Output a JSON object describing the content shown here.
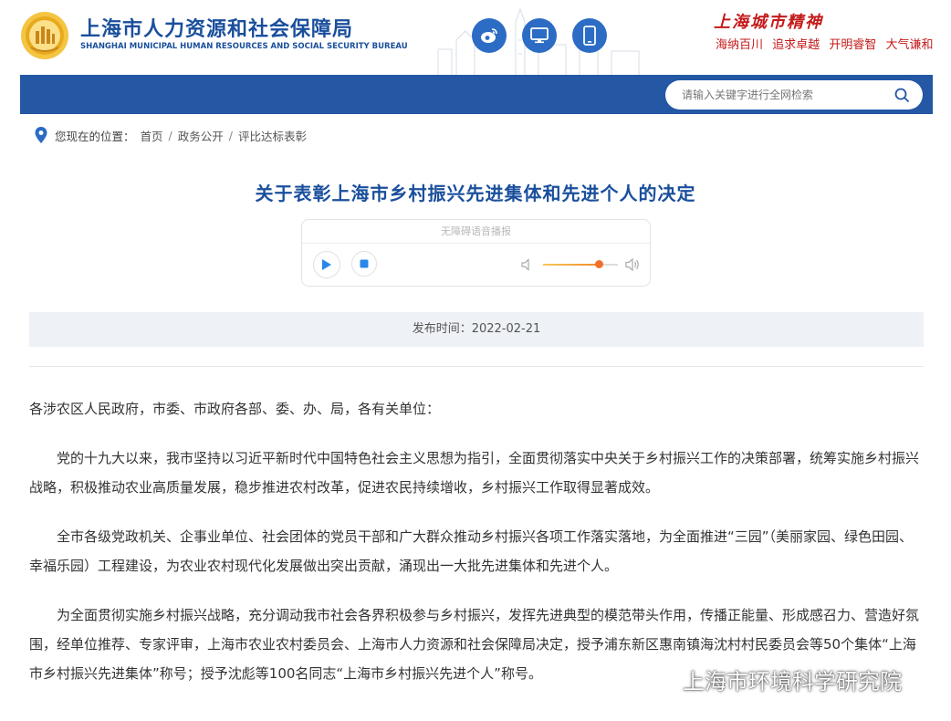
{
  "header": {
    "org_name_cn": "上海市人力资源和社会保障局",
    "org_name_en": "SHANGHAI MUNICIPAL HUMAN RESOURCES AND SOCIAL SECURITY BUREAU",
    "spirit_title": "上海城市精神",
    "spirit_items": [
      "海纳百川",
      "追求卓越",
      "开明睿智",
      "大气谦和"
    ],
    "social_icons": [
      "weibo-icon",
      "desktop-icon",
      "mobile-icon"
    ]
  },
  "search": {
    "placeholder": "请输入关键字进行全网检索"
  },
  "breadcrumb": {
    "label": "您现在的位置：",
    "items": [
      "首页",
      "政务公开",
      "评比达标表彰"
    ]
  },
  "article": {
    "title": "关于表彰上海市乡村振兴先进集体和先进个人的决定",
    "publish_time": "发布时间：2022-02-21",
    "salutation": "各涉农区人民政府，市委、市政府各部、委、办、局，各有关单位：",
    "paragraphs": [
      "党的十九大以来，我市坚持以习近平新时代中国特色社会主义思想为指引，全面贯彻落实中央关于乡村振兴工作的决策部署，统筹实施乡村振兴战略，积极推动农业高质量发展，稳步推进农村改革，促进农民持续增收，乡村振兴工作取得显著成效。",
      "全市各级党政机关、企事业单位、社会团体的党员干部和广大群众推动乡村振兴各项工作落实落地，为全面推进“三园”（美丽家园、绿色田园、幸福乐园）工程建设，为农业农村现代化发展做出突出贡献，涌现出一大批先进集体和先进个人。",
      "为全面贯彻实施乡村振兴战略，充分调动我市社会各界积极参与乡村振兴，发挥先进典型的模范带头作用，传播正能量、形成感召力、营造好氛围，经单位推荐、专家评审，上海市农业农村委员会、上海市人力资源和社会保障局决定，授予浦东新区惠南镇海沈村村民委员会等50个集体“上海市乡村振兴先进集体”称号；授予沈彪等100名同志“上海市乡村振兴先进个人”称号。"
    ]
  },
  "player": {
    "label": "无障碍语音播报",
    "volume": 0.75
  },
  "watermark": {
    "text": "上海市环境科学研究院"
  },
  "colors": {
    "brand_blue": "#1a4f9c",
    "nav_blue": "#2457a4",
    "spirit_red": "#c41a1a",
    "play_blue": "#2a86e8",
    "volume_orange": "#f0702b"
  }
}
